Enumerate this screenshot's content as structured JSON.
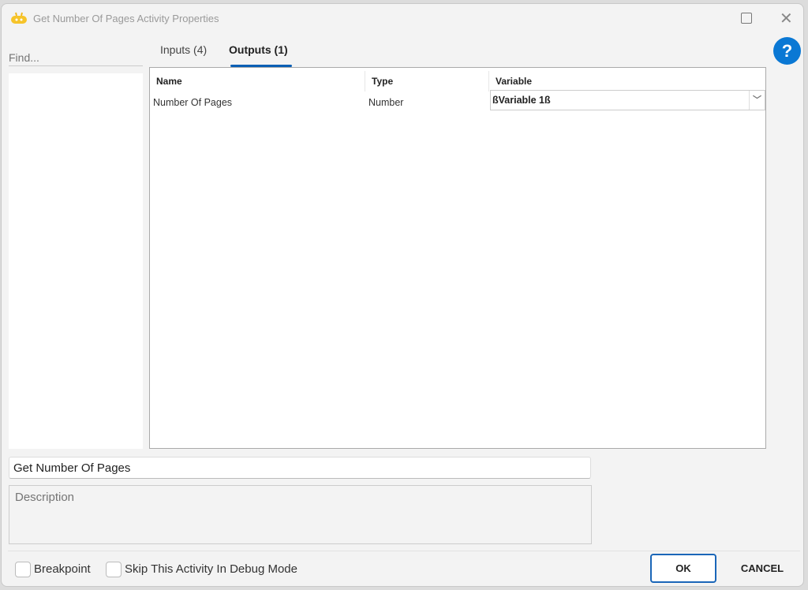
{
  "window": {
    "title": "Get Number Of Pages Activity Properties"
  },
  "find": {
    "placeholder": "Find..."
  },
  "tabs": [
    {
      "label": "Inputs (4)"
    },
    {
      "label": "Outputs (1)"
    }
  ],
  "grid": {
    "columns": [
      "Name",
      "Type",
      "Variable"
    ],
    "rows": [
      {
        "name": "Number Of Pages",
        "type": "Number",
        "variable": "ßVariable 1ß"
      }
    ]
  },
  "activity_name": "Get Number Of Pages",
  "description": {
    "placeholder": "Description"
  },
  "checkboxes": [
    {
      "label": "Breakpoint",
      "checked": false
    },
    {
      "label": "Skip This Activity In Debug Mode",
      "checked": false
    }
  ],
  "buttons": {
    "ok": "OK",
    "cancel": "CANCEL",
    "help": "?"
  }
}
